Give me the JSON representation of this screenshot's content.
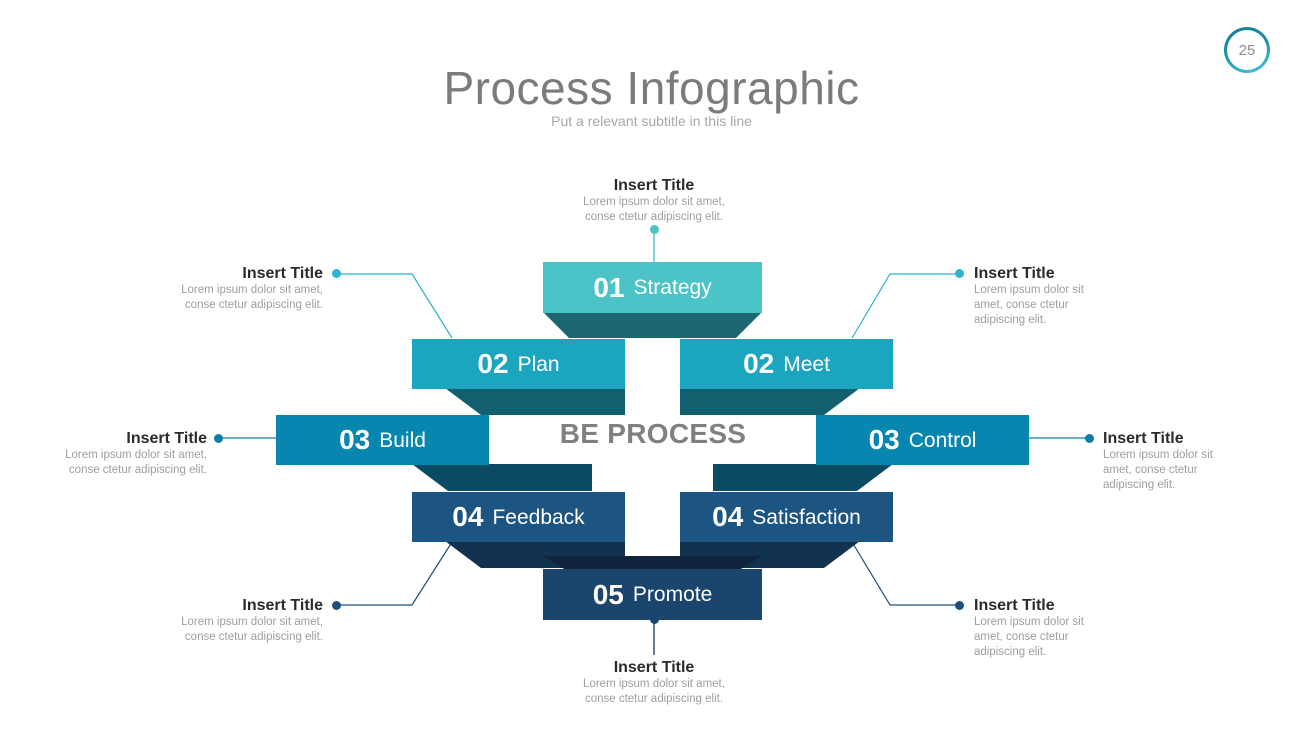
{
  "header": {
    "title": "Process Infographic",
    "subtitle": "Put a relevant subtitle in this line",
    "page_number": "25"
  },
  "center_label": "BE PROCESS",
  "colors": {
    "step01": "#4cc3c6",
    "step01_fold": "#1c6670",
    "step02": "#1ba5bf",
    "step02_fold": "#12606f",
    "step03": "#0787b0",
    "step03_fold": "#0a4b63",
    "step04": "#1d5582",
    "step04_fold": "#123css",
    "step05": "#1c456e",
    "text_gray": "#9e9e9e",
    "title_gray": "#7b7b7b"
  },
  "steps": [
    {
      "number": "01",
      "label": "Strategy",
      "color": "#4cc3c6",
      "fold": "#1c6670"
    },
    {
      "number": "02",
      "label": "Plan",
      "color": "#1ba5bf",
      "fold": "#12606f"
    },
    {
      "number": "02",
      "label": "Meet",
      "color": "#1ba5bf",
      "fold": "#12606f"
    },
    {
      "number": "03",
      "label": "Build",
      "color": "#0787b0",
      "fold": "#0a4b63"
    },
    {
      "number": "03",
      "label": "Control",
      "color": "#0787b0",
      "fold": "#0a4b63"
    },
    {
      "number": "04",
      "label": "Feedback",
      "color": "#1d5582",
      "fold": "#123350"
    },
    {
      "number": "04",
      "label": "Satisfaction",
      "color": "#1d5582",
      "fold": "#123350"
    },
    {
      "number": "05",
      "label": "Promote",
      "color": "#1c456e",
      "fold": "#10243d"
    }
  ],
  "annotations": [
    {
      "title": "Insert Title",
      "line1": "Lorem ipsum dolor sit amet,",
      "line2": "conse ctetur adipiscing elit.",
      "line3": "",
      "dot_color": "#4cc3c6"
    },
    {
      "title": "Insert Title",
      "line1": "Lorem ipsum dolor sit amet,",
      "line2": "conse ctetur adipiscing elit.",
      "line3": "",
      "dot_color": "#2bb5cf"
    },
    {
      "title": "Insert Title",
      "line1": "Lorem ipsum dolor sit",
      "line2": "amet, conse ctetur",
      "line3": "adipiscing elit.",
      "dot_color": "#2bb5cf"
    },
    {
      "title": "Insert Title",
      "line1": "Lorem ipsum dolor sit amet,",
      "line2": "conse ctetur adipiscing elit.",
      "line3": "",
      "dot_color": "#0b7fa6"
    },
    {
      "title": "Insert Title",
      "line1": "Lorem ipsum dolor sit",
      "line2": "amet, conse ctetur",
      "line3": "adipiscing elit.",
      "dot_color": "#0b7fa6"
    },
    {
      "title": "Insert Title",
      "line1": "Lorem ipsum dolor sit amet,",
      "line2": "conse ctetur adipiscing elit.",
      "line3": "",
      "dot_color": "#1d4f7c"
    },
    {
      "title": "Insert Title",
      "line1": "Lorem ipsum dolor sit",
      "line2": "amet, conse ctetur",
      "line3": "adipiscing elit.",
      "dot_color": "#1d4f7c"
    },
    {
      "title": "Insert Title",
      "line1": "Lorem ipsum dolor sit amet,",
      "line2": "conse ctetur adipiscing elit.",
      "line3": "",
      "dot_color": "#1c456e"
    }
  ]
}
